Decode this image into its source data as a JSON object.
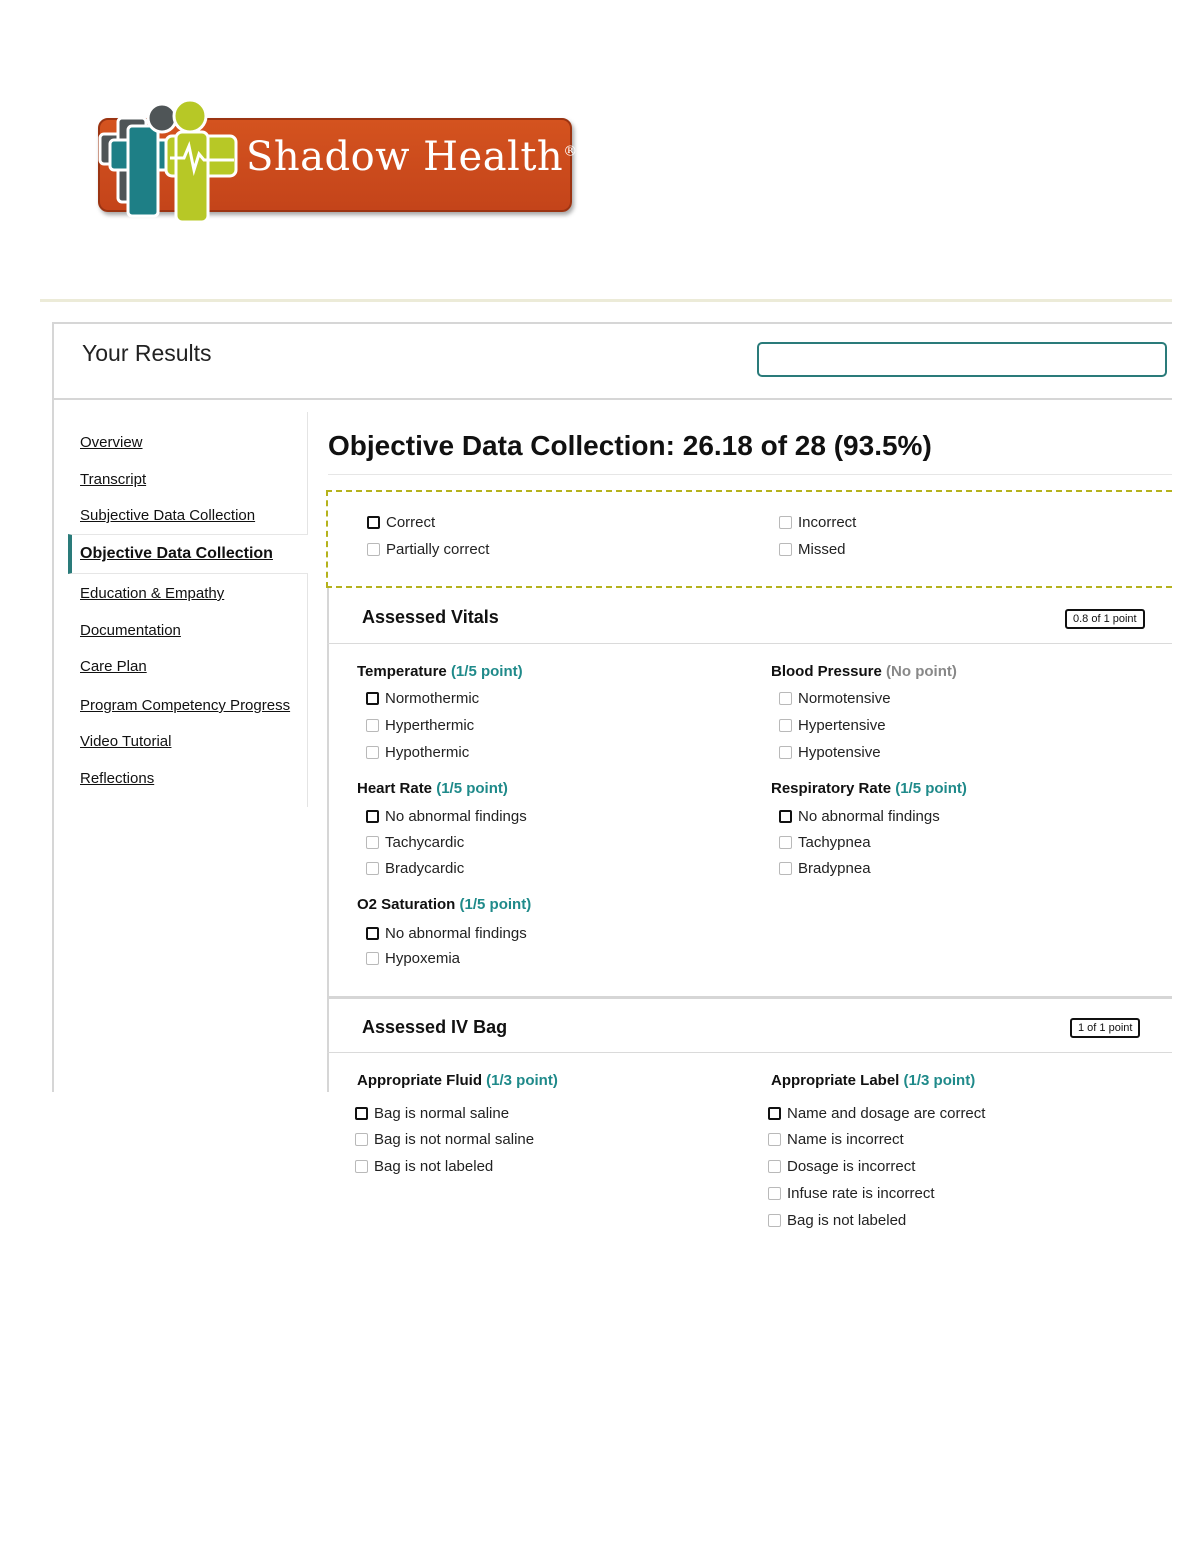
{
  "logo": {
    "text": "Shadow Health",
    "registered": "®"
  },
  "header": {
    "title": "Your Results",
    "search_placeholder": ""
  },
  "sidebar": {
    "items": [
      {
        "label": "Overview",
        "active": false
      },
      {
        "label": "Transcript",
        "active": false
      },
      {
        "label": "Subjective Data Collection",
        "active": false
      },
      {
        "label": "Objective Data Collection",
        "active": true
      },
      {
        "label": "Education & Empathy",
        "active": false
      },
      {
        "label": "Documentation",
        "active": false
      },
      {
        "label": "Care Plan",
        "active": false
      },
      {
        "label": "Program Competency Progress",
        "active": false
      },
      {
        "label": "Video Tutorial",
        "active": false
      },
      {
        "label": "Reflections",
        "active": false
      }
    ]
  },
  "main": {
    "title": "Objective Data Collection: 26.18 of 28 (93.5%)",
    "legend": [
      "Correct",
      "Partially correct",
      "Incorrect",
      "Missed"
    ],
    "sections": [
      {
        "title": "Assessed Vitals",
        "score": "0.8 of 1 point",
        "items": [
          {
            "label": "Temperature",
            "points": "(1/5 point)",
            "options": [
              "Normothermic",
              "Hyperthermic",
              "Hypothermic"
            ]
          },
          {
            "label": "Blood Pressure",
            "points": "(No point)",
            "options": [
              "Normotensive",
              "Hypertensive",
              "Hypotensive"
            ]
          },
          {
            "label": "Heart Rate",
            "points": "(1/5 point)",
            "options": [
              "No abnormal findings",
              "Tachycardic",
              "Bradycardic"
            ]
          },
          {
            "label": "Respiratory Rate",
            "points": "(1/5 point)",
            "options": [
              "No abnormal findings",
              "Tachypnea",
              "Bradypnea"
            ]
          },
          {
            "label": "O2 Saturation",
            "points": "(1/5 point)",
            "options": [
              "No abnormal findings",
              "Hypoxemia"
            ]
          }
        ]
      },
      {
        "title": "Assessed IV Bag",
        "score": "1 of 1 point",
        "items": [
          {
            "label": "Appropriate Fluid",
            "points": "(1/3 point)",
            "options": [
              "Bag is normal saline",
              "Bag is not normal saline",
              "Bag is not labeled"
            ]
          },
          {
            "label": "Appropriate Label",
            "points": "(1/3 point)",
            "options": [
              "Name and dosage are correct",
              "Name is incorrect",
              "Dosage is incorrect",
              "Infuse rate is incorrect",
              "Bag is not labeled"
            ]
          }
        ]
      }
    ]
  },
  "colors": {
    "accent": "#2a7b7a",
    "points": "#1f8a8a",
    "legend_border": "#b5b21c",
    "logo_bg": "#c4441a"
  }
}
